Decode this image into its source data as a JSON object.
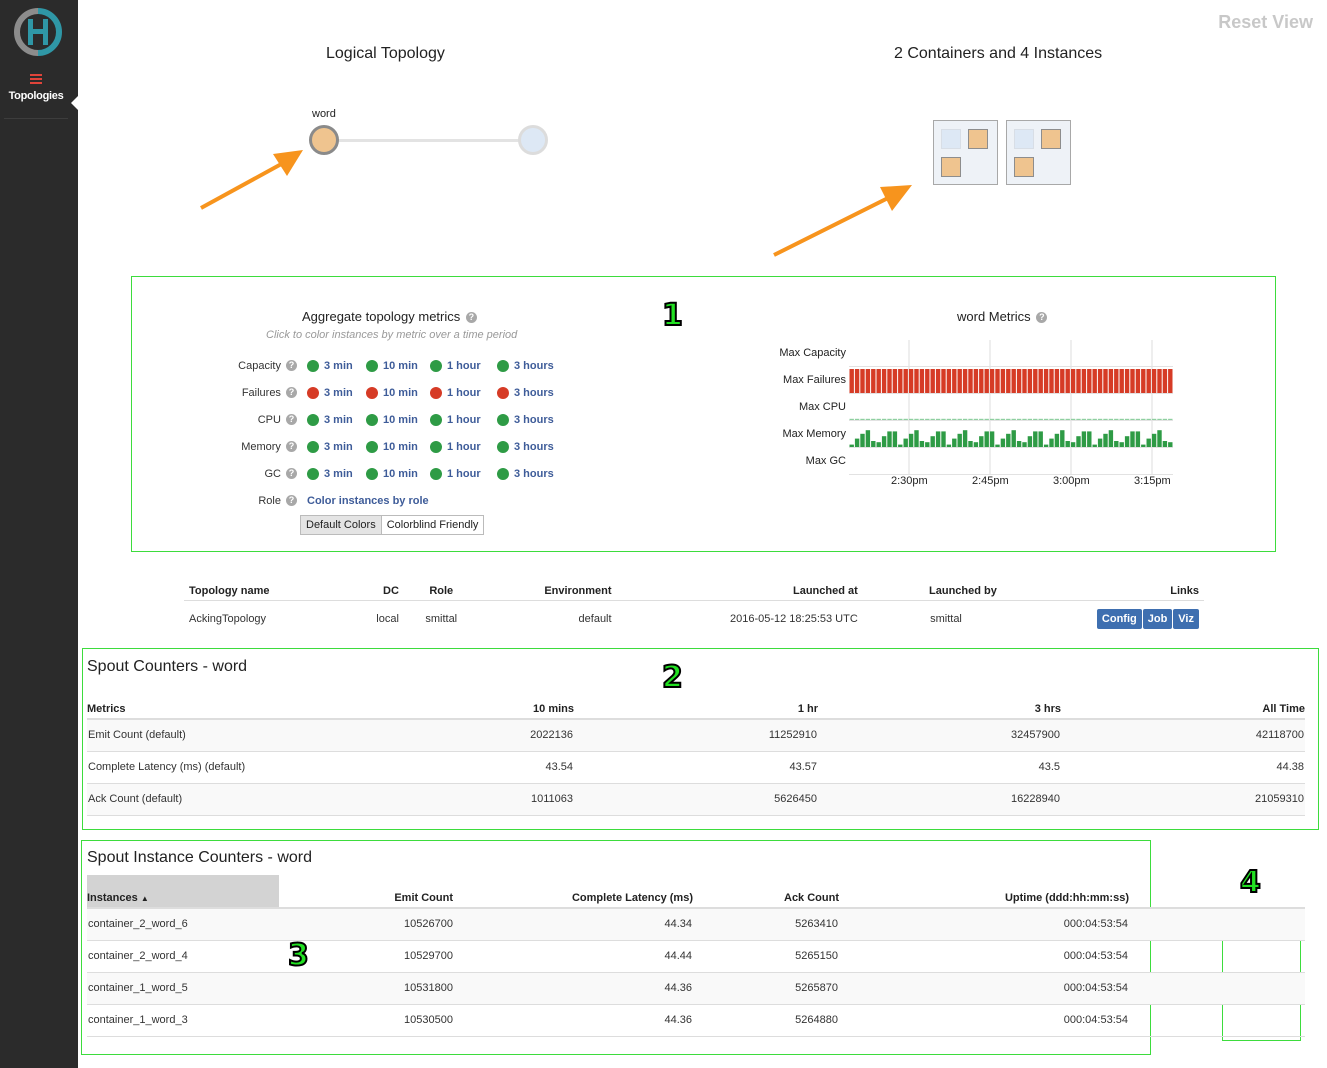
{
  "sidebar": {
    "logo_icon": "heron-logo",
    "items": [
      {
        "label": "Topologies",
        "icon": "hamburger-icon",
        "active": true
      }
    ]
  },
  "header": {
    "reset_view": "Reset View"
  },
  "logical_topology": {
    "title": "Logical Topology",
    "nodes": [
      {
        "label": "word",
        "color": "#efc48f"
      },
      {
        "label": "",
        "color": "#dde8f5"
      }
    ]
  },
  "physical_topology": {
    "title": "2 Containers and 4 Instances",
    "containers": [
      {
        "instances": [
          "bolt",
          "spout",
          "spout"
        ]
      },
      {
        "instances": [
          "bolt",
          "spout",
          "spout"
        ]
      }
    ]
  },
  "annotations": [
    "1",
    "2",
    "3",
    "4"
  ],
  "aggregate_metrics": {
    "title": "Aggregate topology metrics",
    "subtitle": "Click to color instances by metric over a time period",
    "periods": [
      "3 min",
      "10 min",
      "1 hour",
      "3 hours"
    ],
    "rows": [
      {
        "label": "Capacity",
        "status": "green"
      },
      {
        "label": "Failures",
        "status": "red"
      },
      {
        "label": "CPU",
        "status": "green"
      },
      {
        "label": "Memory",
        "status": "green"
      },
      {
        "label": "GC",
        "status": "green"
      }
    ],
    "role_label": "Role",
    "role_link": "Color instances by role",
    "color_buttons": [
      "Default Colors",
      "Colorblind Friendly"
    ],
    "active_color_button": "Default Colors",
    "colors": {
      "green": "#2e9b45",
      "red": "#d63b26",
      "link": "#3e5c99"
    }
  },
  "word_metrics": {
    "title": "word Metrics",
    "rows": [
      "Max Capacity",
      "Max Failures",
      "Max CPU",
      "Max Memory",
      "Max GC"
    ],
    "time_ticks": [
      "2:30pm",
      "2:45pm",
      "3:00pm",
      "3:15pm"
    ]
  },
  "chart_data": {
    "type": "bar",
    "title": "word Metrics",
    "xlabel": "",
    "ylabel": "",
    "x_ticks": [
      "2:30pm",
      "2:45pm",
      "3:00pm",
      "3:15pm"
    ],
    "bars_per_series": 60,
    "series": [
      {
        "name": "Max Capacity",
        "color": "#2e9b45",
        "level": 0.0
      },
      {
        "name": "Max Failures",
        "color": "#d63b26",
        "level": 1.0
      },
      {
        "name": "Max CPU",
        "color": "#8fcfa0",
        "level": 0.05
      },
      {
        "name": "Max Memory",
        "color": "#2e9b45",
        "pattern": [
          0.1,
          0.35,
          0.55,
          0.7,
          0.25,
          0.2,
          0.45,
          0.65,
          0.65
        ]
      },
      {
        "name": "Max GC",
        "color": "#2e9b45",
        "level": 0.0
      }
    ]
  },
  "topology_info": {
    "columns": [
      "Topology name",
      "DC",
      "Role",
      "Environment",
      "Launched at",
      "Launched by",
      "Links"
    ],
    "row": {
      "name": "AckingTopology",
      "dc": "local",
      "role": "smittal",
      "environment": "default",
      "launched_at": "2016-05-12 18:25:53 UTC",
      "launched_by": "smittal"
    },
    "links": [
      "Config",
      "Job",
      "Viz"
    ]
  },
  "spout_counters": {
    "title": "Spout Counters - word",
    "columns": [
      "Metrics",
      "10 mins",
      "1 hr",
      "3 hrs",
      "All Time"
    ],
    "rows": [
      [
        "Emit Count (default)",
        "2022136",
        "11252910",
        "32457900",
        "42118700"
      ],
      [
        "Complete Latency (ms) (default)",
        "43.54",
        "43.57",
        "43.5",
        "44.38"
      ],
      [
        "Ack Count (default)",
        "1011063",
        "5626450",
        "16228940",
        "21059310"
      ]
    ]
  },
  "instance_counters": {
    "title": "Spout Instance Counters - word",
    "columns": [
      "Instances",
      "Emit Count",
      "Complete Latency (ms)",
      "Ack Count",
      "Uptime (ddd:hh:mm:ss)"
    ],
    "sort_indicator": "▲",
    "rows": [
      [
        "container_2_word_6",
        "10526700",
        "44.34",
        "5263410",
        "000:04:53:54"
      ],
      [
        "container_2_word_4",
        "10529700",
        "44.44",
        "5265150",
        "000:04:53:54"
      ],
      [
        "container_1_word_5",
        "10531800",
        "44.36",
        "5265870",
        "000:04:53:54"
      ],
      [
        "container_1_word_3",
        "10530500",
        "44.36",
        "5264880",
        "000:04:53:54"
      ]
    ]
  }
}
